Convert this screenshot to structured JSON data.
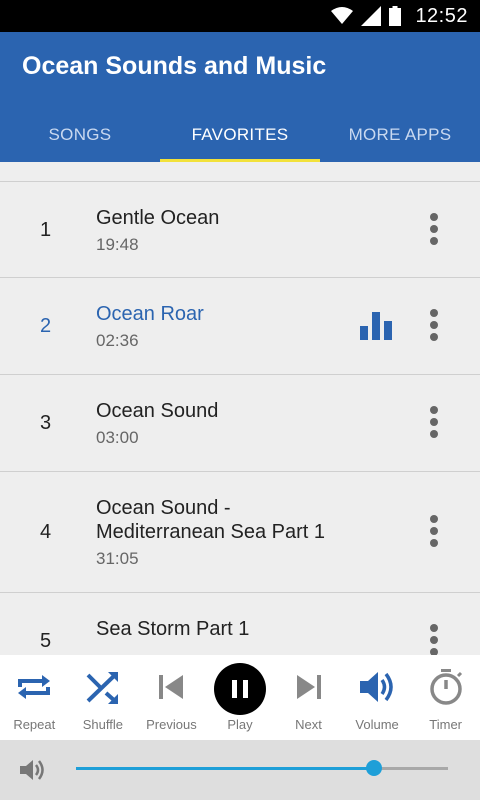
{
  "status_bar": {
    "time": "12:52",
    "icons": [
      "wifi-icon",
      "signal-icon",
      "battery-icon"
    ]
  },
  "app": {
    "title": "Ocean Sounds and Music"
  },
  "tabs": [
    {
      "label": "SONGS",
      "active": false
    },
    {
      "label": "FAVORITES",
      "active": true
    },
    {
      "label": "MORE APPS",
      "active": false
    }
  ],
  "tracks": [
    {
      "number": "1",
      "title": "Gentle Ocean",
      "duration": "19:48",
      "playing": false
    },
    {
      "number": "2",
      "title": "Ocean Roar",
      "duration": "02:36",
      "playing": true
    },
    {
      "number": "3",
      "title": "Ocean Sound",
      "duration": "03:00",
      "playing": false
    },
    {
      "number": "4",
      "title": "Ocean Sound - Mediterranean Sea Part 1",
      "duration": "31:05",
      "playing": false
    },
    {
      "number": "5",
      "title": "Sea Storm Part 1",
      "duration": "",
      "playing": false
    }
  ],
  "controls": {
    "repeat": "Repeat",
    "shuffle": "Shuffle",
    "previous": "Previous",
    "play": "Play",
    "next": "Next",
    "volume": "Volume",
    "timer": "Timer"
  },
  "volume": {
    "level_percent": 80
  },
  "colors": {
    "primary": "#2b64b0",
    "tab_indicator": "#f2e13a",
    "slider": "#1e9fd8",
    "active_control": "#2b64b0"
  }
}
